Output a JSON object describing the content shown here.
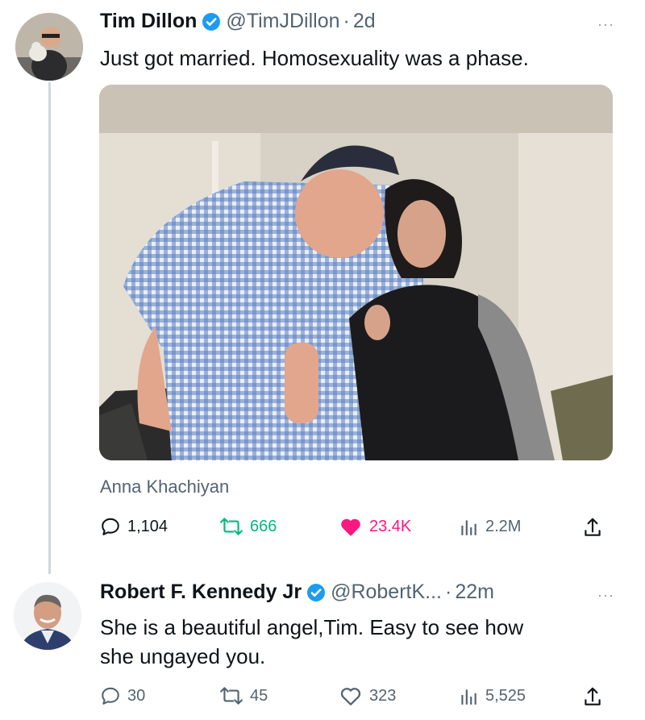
{
  "tweet1": {
    "author": "Tim Dillon",
    "handle": "@TimJDillon",
    "dot": "·",
    "time": "2d",
    "more": "···",
    "text": "Just got married. Homosexuality was a phase.",
    "media_caption": "Anna Khachiyan",
    "stats": {
      "replies": "1,104",
      "retweets": "666",
      "likes": "23.4K",
      "views": "2.2M"
    },
    "retweet_color": "#00ba7c",
    "like_color": "#f91880"
  },
  "tweet2": {
    "author": "Robert F. Kennedy Jr",
    "handle": "@RobertK...",
    "dot": "·",
    "time": "22m",
    "more": "···",
    "text_line1": "She is a beautiful angel,Tim. Easy to see how",
    "text_line2": "she ungayed you.",
    "stats": {
      "replies": "30",
      "retweets": "45",
      "likes": "323",
      "views": "5,525"
    }
  },
  "colors": {
    "verified": "#1d9bf0",
    "muted": "#536471",
    "text": "#0f1419",
    "thread_line": "#cfd9de"
  },
  "icons": [
    "reply-icon",
    "retweet-icon",
    "like-icon",
    "views-icon",
    "share-icon",
    "verified-badge-icon"
  ]
}
